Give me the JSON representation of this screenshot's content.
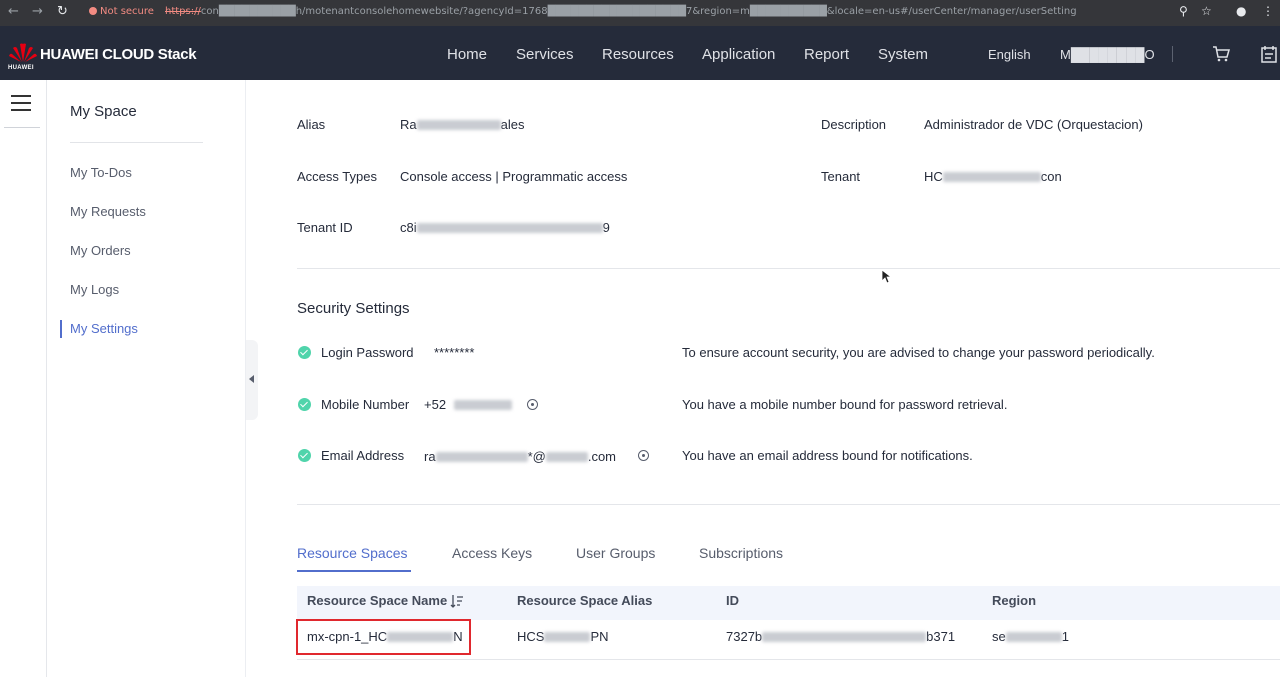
{
  "browser": {
    "not_secure": "Not secure",
    "url_scheme": "https://",
    "url_rest": "con██████████h/motenantconsolehomewebsite/?agencyId=1768██████████████████7&region=m██████████&locale=en-us#/userCenter/manager/userSetting"
  },
  "header": {
    "logo_text": "HUAWEI",
    "brand": "HUAWEI CLOUD Stack",
    "menu": [
      "Home",
      "Services",
      "Resources",
      "Application",
      "Report",
      "System"
    ],
    "language": "English",
    "user": "M████████O"
  },
  "sidebar": {
    "title": "My Space",
    "items": [
      {
        "label": "My To-Dos"
      },
      {
        "label": "My Requests"
      },
      {
        "label": "My Orders"
      },
      {
        "label": "My Logs"
      },
      {
        "label": "My Settings"
      }
    ]
  },
  "profile": {
    "alias_label": "Alias",
    "alias_prefix": "Ra",
    "alias_suffix": "ales",
    "description_label": "Description",
    "description_value": "Administrador de VDC (Orquestacion)",
    "access_types_label": "Access Types",
    "access_types_value": "Console access | Programmatic access",
    "tenant_label": "Tenant",
    "tenant_prefix": "HC",
    "tenant_suffix": "con",
    "tenant_id_label": "Tenant ID",
    "tenant_id_prefix": "c8i",
    "tenant_id_suffix": "9"
  },
  "security": {
    "title": "Security Settings",
    "login_password_label": "Login Password",
    "login_password_value": "********",
    "login_password_hint": "To ensure account security, you are advised to change your password periodically.",
    "mobile_label": "Mobile Number",
    "mobile_prefix": "+52",
    "mobile_hint": "You have a mobile number bound for password retrieval.",
    "email_label": "Email Address",
    "email_prefix": "ra",
    "email_suffix": "*@",
    "email_tail": ".com",
    "email_hint": "You have an email address bound for notifications."
  },
  "tabs": [
    "Resource Spaces",
    "Access Keys",
    "User Groups",
    "Subscriptions"
  ],
  "table": {
    "columns": [
      "Resource Space Name",
      "Resource Space Alias",
      "ID",
      "Region"
    ],
    "row": {
      "name_prefix": "mx-cpn-1_HC",
      "name_suffix": "N",
      "alias_prefix": "HCS",
      "alias_suffix": "PN",
      "id_prefix": "7327b",
      "id_suffix": "b371",
      "region_prefix": "se",
      "region_suffix": "1"
    }
  },
  "colors": {
    "nav_bg": "#252b3a",
    "accent": "#526ecc",
    "success": "#50d4ab",
    "highlight": "#e0282e"
  }
}
